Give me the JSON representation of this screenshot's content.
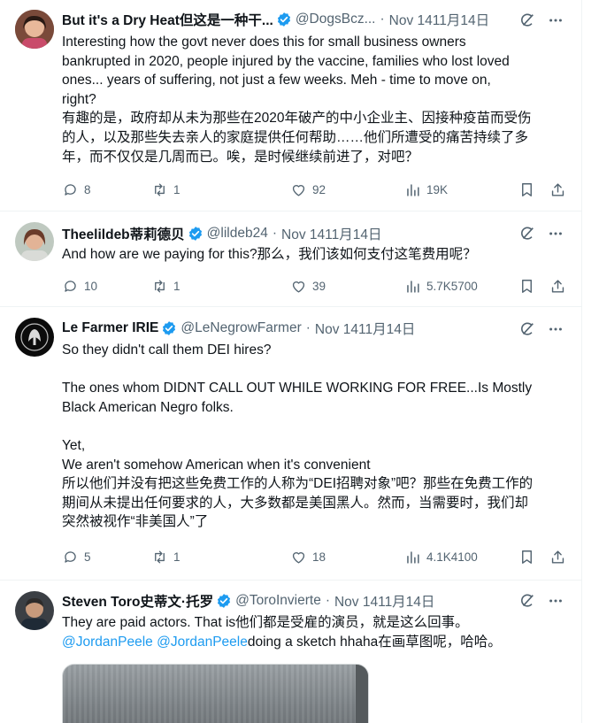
{
  "tweets": [
    {
      "name": "But it's a Dry Heat但这是一种干...",
      "handle": "@DogsBcz...",
      "time": "Nov 1411月14日",
      "lines": [
        "Interesting how the govt never does this for small business owners",
        "bankrupted in 2020, people injured by the vaccine, families who lost loved",
        "ones... years of suffering, not just a few weeks. Meh - time to move on,",
        "right?",
        "有趣的是，政府却从未为那些在2020年破产的中小企业主、因接种疫苗而受伤",
        "的人，以及那些失去亲人的家庭提供任何帮助……他们所遭受的痛苦持续了多",
        "年，而不仅仅是几周而已。唉，是时候继续前进了，对吧？"
      ],
      "replies": "8",
      "retweets": "1",
      "likes": "92",
      "views": "19K"
    },
    {
      "name": "Theelildeb蒂莉德贝",
      "handle": "@lildeb24",
      "time": "Nov 1411月14日",
      "lines": [
        "And how are we paying for this?那么，我们该如何支付这笔费用呢？"
      ],
      "replies": "10",
      "retweets": "1",
      "likes": "39",
      "views": "5.7K5700"
    },
    {
      "name": "Le Farmer IRIE",
      "handle": "@LeNegrowFarmer",
      "time": "Nov 1411月14日",
      "lines": [
        "So they didn't call them DEI hires?",
        "",
        "The ones whom DIDNT CALL OUT WHILE WORKING FOR FREE...Is Mostly",
        "Black American Negro folks.",
        "",
        "Yet,",
        "We aren't somehow American when it's convenient",
        "所以他们并没有把这些免费工作的人称为“DEI招聘对象”吧？那些在免费工作的",
        "期间从未提出任何要求的人，大多数都是美国黑人。然而，当需要时，我们却",
        "突然被视作“非美国人”了"
      ],
      "replies": "5",
      "retweets": "1",
      "likes": "18",
      "views": "4.1K4100"
    },
    {
      "name": "Steven Toro史蒂文·托罗",
      "handle": "@ToroInvierte",
      "time": "Nov 1411月14日",
      "line1": "They are paid actors. That is他们都是受雇的演员，就是这么回事。",
      "mention1": "@JordanPeele",
      "mention2": "@JordanPeele",
      "line2_rest": "doing a sketch hhaha在画草图呢，哈哈。"
    }
  ],
  "colors": {
    "accent": "#1d9bf0",
    "muted": "#536471",
    "text": "#0f1419"
  },
  "icons": [
    "verified-badge-icon",
    "grok-icon",
    "more-icon",
    "reply-icon",
    "retweet-icon",
    "like-icon",
    "views-icon",
    "bookmark-icon",
    "share-icon"
  ]
}
